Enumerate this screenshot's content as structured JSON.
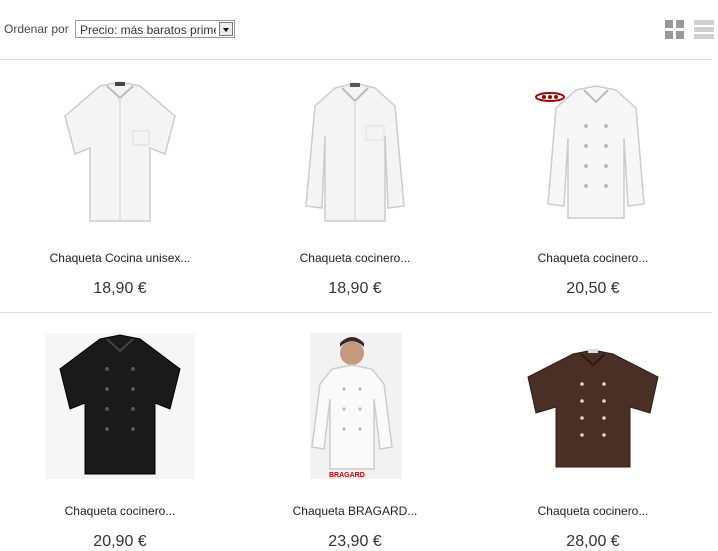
{
  "toolbar": {
    "sort_label": "Ordenar por",
    "sort_selected": "Precio: más baratos primero",
    "grid_view_icon": "grid-icon",
    "list_view_icon": "list-icon"
  },
  "products": [
    {
      "name": "Chaqueta Cocina unisex...",
      "price": "18,90 €",
      "image": "white short-sleeve chef jacket"
    },
    {
      "name": "Chaqueta cocinero...",
      "price": "18,90 €",
      "image": "white long-sleeve chef jacket"
    },
    {
      "name": "Chaqueta cocinero...",
      "price": "20,50 €",
      "image": "white long-sleeve chef jacket with logo"
    },
    {
      "name": "Chaqueta cocinero...",
      "price": "20,90 €",
      "image": "black short-sleeve chef jacket"
    },
    {
      "name": "Chaqueta BRAGARD...",
      "price": "23,90 €",
      "image": "man in white chef jacket",
      "brand_mark": "BRAGARD"
    },
    {
      "name": "Chaqueta cocinero...",
      "price": "28,00 €",
      "image": "brown short-sleeve chef jacket"
    }
  ]
}
